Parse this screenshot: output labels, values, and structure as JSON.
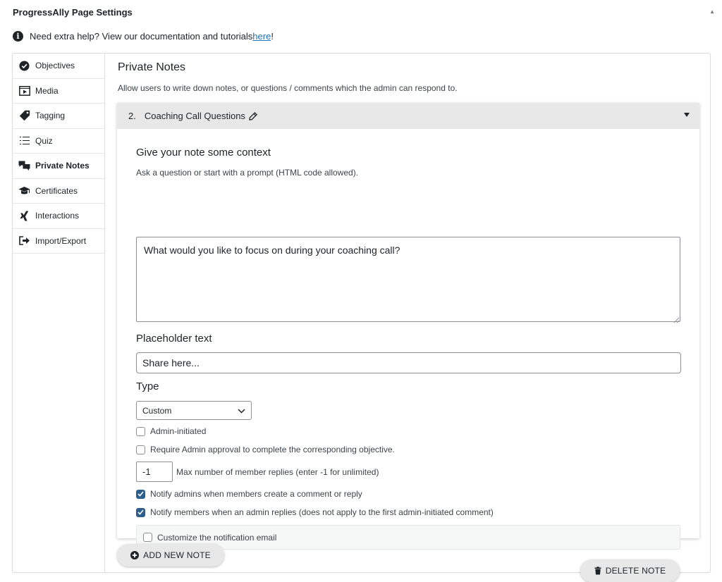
{
  "header": {
    "title": "ProgressAlly Page Settings",
    "help_prefix": "Need extra help? View our documentation and tutorials ",
    "help_link": "here",
    "help_suffix": "!"
  },
  "sidebar": {
    "items": [
      {
        "label": "Objectives",
        "icon": "check-circle-icon"
      },
      {
        "label": "Media",
        "icon": "media-player-icon"
      },
      {
        "label": "Tagging",
        "icon": "tag-icon"
      },
      {
        "label": "Quiz",
        "icon": "list-icon"
      },
      {
        "label": "Private Notes",
        "icon": "chat-bubbles-icon",
        "active": true
      },
      {
        "label": "Certificates",
        "icon": "graduation-cap-icon"
      },
      {
        "label": "Interactions",
        "icon": "xing-icon"
      },
      {
        "label": "Import/Export",
        "icon": "export-arrow-icon"
      }
    ]
  },
  "main": {
    "title": "Private Notes",
    "description": "Allow users to write down notes, or questions / comments which the admin can respond to."
  },
  "note": {
    "number": "2.",
    "title": "Coaching Call Questions",
    "context_label": "Give your note some context",
    "context_hint": "Ask a question or start with a prompt (HTML code allowed).",
    "context_value": "What would you like to focus on during your coaching call?",
    "placeholder_label": "Placeholder text",
    "placeholder_value": "Share here...",
    "type_label": "Type",
    "type_value": "Custom",
    "admin_initiated": "Admin-initiated",
    "require_approval": "Require Admin approval to complete the corresponding objective.",
    "max_replies_value": "-1",
    "max_replies_label": "Max number of member replies (enter -1 for unlimited)",
    "notify_admins": "Notify admins when members create a comment or reply",
    "notify_members": "Notify members when an admin replies (does not apply to the first admin-initiated comment)",
    "customize_email": "Customize the notification email",
    "delete_label": "DELETE NOTE"
  },
  "add_note_label": "ADD NEW NOTE",
  "colors": {
    "checkbox_checked": "#2c5f8d",
    "link": "#2271b1"
  }
}
